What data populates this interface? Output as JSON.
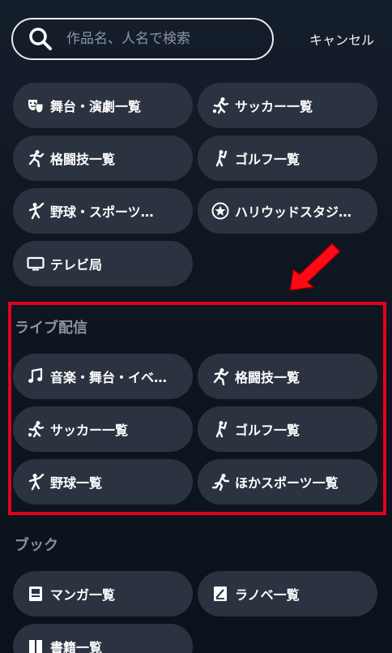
{
  "header": {
    "search_placeholder": "作品名、人名で検索",
    "cancel_label": "キャンセル"
  },
  "top_categories": [
    {
      "label": "舞台・演劇一覧",
      "icon": "theater-masks-icon"
    },
    {
      "label": "サッカー一覧",
      "icon": "soccer-player-icon"
    },
    {
      "label": "格闘技一覧",
      "icon": "martial-arts-icon"
    },
    {
      "label": "ゴルフ一覧",
      "icon": "golf-icon"
    },
    {
      "label": "野球・スポーツ…",
      "icon": "baseball-icon"
    },
    {
      "label": "ハリウッドスタジ…",
      "icon": "star-badge-icon"
    },
    {
      "label": "テレビ局",
      "icon": "tv-icon"
    }
  ],
  "live": {
    "title": "ライブ配信",
    "items": [
      {
        "label": "音楽・舞台・イベ…",
        "icon": "music-note-icon"
      },
      {
        "label": "格闘技一覧",
        "icon": "martial-arts-icon"
      },
      {
        "label": "サッカー一覧",
        "icon": "soccer-player-icon"
      },
      {
        "label": "ゴルフ一覧",
        "icon": "golf-icon"
      },
      {
        "label": "野球一覧",
        "icon": "baseball-icon"
      },
      {
        "label": "ほかスポーツ一覧",
        "icon": "running-icon"
      }
    ]
  },
  "books": {
    "title": "ブック",
    "items": [
      {
        "label": "マンガ一覧",
        "icon": "manga-book-icon"
      },
      {
        "label": "ラノベ一覧",
        "icon": "light-novel-icon"
      },
      {
        "label": "書籍一覧",
        "icon": "books-icon"
      }
    ]
  },
  "colors": {
    "background": "#0d141e",
    "pill": "#2b3340",
    "section_title": "#8b929c",
    "highlight": "#e5001f"
  }
}
